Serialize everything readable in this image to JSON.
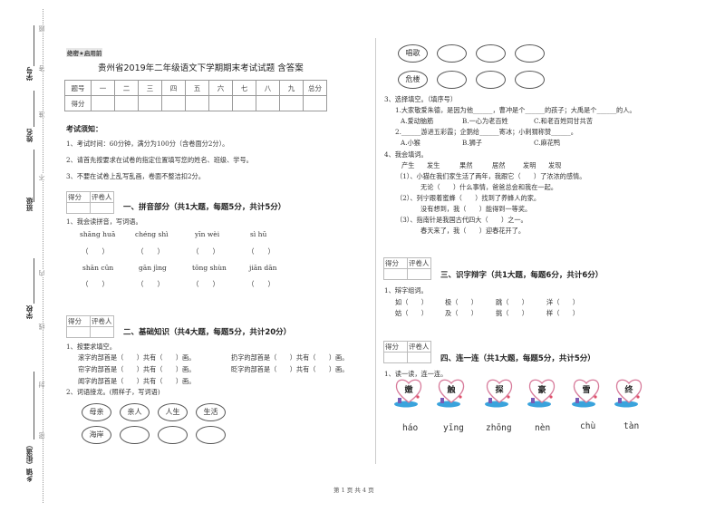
{
  "margin": {
    "labels": [
      "学号",
      "姓名",
      "班级",
      "学校",
      "乡镇（街道）"
    ],
    "seal_chars": [
      "题",
      "答",
      "准",
      "不",
      "内",
      "线",
      "封",
      "密"
    ]
  },
  "header": {
    "secret_tag": "绝密★启用前",
    "title": "贵州省2019年二年级语文下学期期末考试试题 含答案"
  },
  "score_table": {
    "row1": [
      "题号",
      "一",
      "二",
      "三",
      "四",
      "五",
      "六",
      "七",
      "八",
      "九",
      "总分"
    ],
    "row2_label": "得分"
  },
  "notice": {
    "heading": "考试须知：",
    "items": [
      "1、考试时间：60分钟，满分为100分（含卷面分2分）。",
      "2、请首先按要求在试卷的指定位置填写您的姓名、班级、学号。",
      "3、不要在试卷上乱写乱画，卷面不整洁扣2分。"
    ]
  },
  "grader": {
    "score": "得分",
    "reviewer": "评卷人"
  },
  "section1": {
    "title": "一、拼音部分（共1大题，每题5分，共计5分）",
    "q1": "1、我会读拼音，写词语。",
    "pinyin_row1": [
      "shāng huā",
      "chéng shì",
      "yīn wèi",
      "sì hū"
    ],
    "pinyin_row2": [
      "shān cūn",
      "gān jìng",
      "tōng shùn",
      "jiān dān"
    ],
    "blank": "（　　）"
  },
  "section2": {
    "title": "二、基础知识（共4大题，每题5分，共计20分）",
    "q1": "1、按要求填空。",
    "fill_left": [
      "滚字的部首是（　　）共有（　　）画。",
      "帘字的部首是（　　）共有（　　）画。",
      "闻字的部首是（　　）共有（　　）画。"
    ],
    "fill_right": [
      "扔字的部首是（　　）共有（　　）画。",
      "眨字的部首是（　　）共有（　　）画。"
    ],
    "q2": "2、词语接龙。(照样子，写词语)",
    "ovals_row1": [
      "母亲",
      "亲人",
      "人生",
      "生活"
    ],
    "ovals_row2": [
      "海岸",
      "",
      "",
      ""
    ],
    "ovals_row3": [
      "唱歌",
      "",
      "",
      ""
    ],
    "ovals_row4": [
      "危楼",
      "",
      "",
      ""
    ]
  },
  "q3": {
    "title": "3、选择填空。（填序号）",
    "s1": "1.大家敬爱朱德，是因为他______，曹冲是个______的孩子；大禹是个______的人。",
    "s1_opts": [
      "A.爱动脑筋",
      "B.一心为老百姓",
      "C.和老百姓同甘共苦"
    ],
    "s2": "2.______游进五彩霞；企鹅给______寄冰；小刺猬称赞______。",
    "s2_opts": [
      "A.小猴",
      "B.狮子",
      "C.麻花鸭"
    ]
  },
  "q4": {
    "title": "4、我会填词。",
    "words": [
      "产生",
      "发生",
      "果然",
      "居然",
      "发明",
      "发现"
    ],
    "lines": [
      "（1）、小猫在我们家生活了两年，我跟它（　　）了浓浓的感情。",
      "无论（　　）什么事情，爸爸总会和我在一起。",
      "（2）、列宁跟着蜜蜂（　　）找到了养蜂人的家。",
      "没有想到，我（　　）能得到一等奖。",
      "（3）、指南针是我国古代四大（　　）之一。",
      "春天来了，我（　　）迎春花开了。"
    ]
  },
  "section3": {
    "title": "三、识字辩字（共1大题，每题6分，共计6分）",
    "q1": "1、辩字组词。",
    "row1": [
      "如（　　）",
      "极（　　）",
      "跳（　　）",
      "洋（　　）"
    ],
    "row2": [
      "姑（　　）",
      "及（　　）",
      "挑（　　）",
      "样（　　）"
    ]
  },
  "section4": {
    "title": "四、连一连（共1大题，每题5分，共计5分）",
    "q1": "1、读一读，连一连。",
    "hearts": [
      "嫩",
      "触",
      "探",
      "豪",
      "雪",
      "终"
    ],
    "pinyin": [
      "háo",
      "yīng",
      "zhōng",
      "nèn",
      "chù",
      "tàn"
    ]
  },
  "footer": {
    "page": "第 1 页 共 4 页"
  },
  "colors": {
    "heart_outline": "#d77a9a",
    "heart_water": "#3aa3dc",
    "text": "#222222"
  }
}
